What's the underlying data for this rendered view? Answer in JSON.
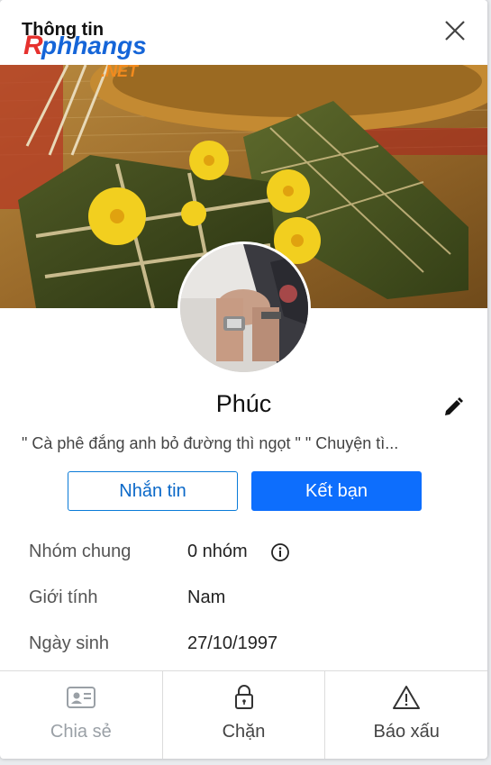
{
  "header": {
    "title": "Thông tin",
    "close_icon": "close-icon"
  },
  "watermark": {
    "text_main": "Phhangs",
    "text_prefix": "R",
    "text_suffix": ".NET"
  },
  "profile": {
    "name": "Phúc",
    "bio": "\" Cà phê đắng anh bỏ đường thì ngọt \" \" Chuyện tì...",
    "edit_icon": "pencil-icon"
  },
  "actions": {
    "message_label": "Nhắn tin",
    "add_friend_label": "Kết bạn"
  },
  "info": [
    {
      "label": "Nhóm chung",
      "value": "0 nhóm",
      "has_info_icon": true
    },
    {
      "label": "Giới tính",
      "value": "Nam",
      "has_info_icon": false
    },
    {
      "label": "Ngày sinh",
      "value": "27/10/1997",
      "has_info_icon": false
    }
  ],
  "footer": [
    {
      "label": "Chia sẻ",
      "icon": "id-card-icon",
      "enabled": false
    },
    {
      "label": "Chặn",
      "icon": "lock-icon",
      "enabled": true
    },
    {
      "label": "Báo xấu",
      "icon": "warning-icon",
      "enabled": true
    }
  ],
  "colors": {
    "primary": "#0d6efd",
    "outline_button": "#0a7bd8",
    "footer_disabled": "#9aa0a6"
  }
}
